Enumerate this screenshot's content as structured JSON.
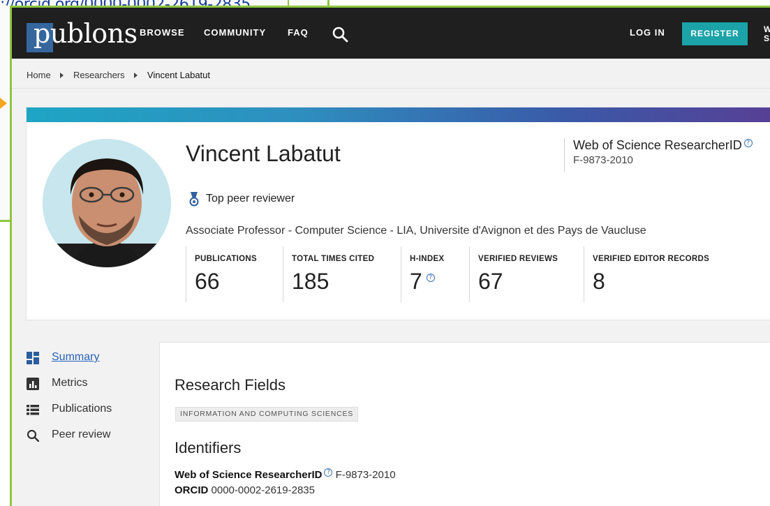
{
  "background": {
    "url_fragment": "://orcid.org/0000-0002-2619-2835"
  },
  "header": {
    "logo_text": "publons",
    "nav": [
      "BROWSE",
      "COMMUNITY",
      "FAQ"
    ],
    "login_label": "LOG IN",
    "register_label": "REGISTER",
    "extra_line1": "W",
    "extra_line2": "S",
    "brand_color": "#1ba3a7"
  },
  "breadcrumb": {
    "items": [
      "Home",
      "Researchers",
      "Vincent Labatut"
    ]
  },
  "profile": {
    "name": "Vincent Labatut",
    "award": "Top peer reviewer",
    "affiliation": "Associate Professor - Computer Science - LIA, Universite d'Avignon et des Pays de Vaucluse",
    "wos_title": "Web of Science ResearcherID",
    "wos_id": "F-9873-2010",
    "stats": [
      {
        "label": "PUBLICATIONS",
        "value": "66"
      },
      {
        "label": "TOTAL TIMES CITED",
        "value": "185"
      },
      {
        "label": "H-INDEX",
        "value": "7"
      },
      {
        "label": "VERIFIED REVIEWS",
        "value": "67"
      },
      {
        "label": "VERIFIED EDITOR RECORDS",
        "value": "8"
      }
    ]
  },
  "sidebar": {
    "items": [
      {
        "label": "Summary",
        "icon": "dashboard-icon",
        "active": true
      },
      {
        "label": "Metrics",
        "icon": "bar-chart-icon",
        "active": false
      },
      {
        "label": "Publications",
        "icon": "list-icon",
        "active": false
      },
      {
        "label": "Peer review",
        "icon": "search-icon",
        "active": false
      }
    ]
  },
  "main": {
    "research_fields_title": "Research Fields",
    "research_field_chip": "INFORMATION AND COMPUTING SCIENCES",
    "identifiers_title": "Identifiers",
    "wos_label": "Web of Science ResearcherID",
    "wos_value": "F-9873-2010",
    "orcid_label": "ORCID",
    "orcid_value": "0000-0002-2619-2835"
  }
}
